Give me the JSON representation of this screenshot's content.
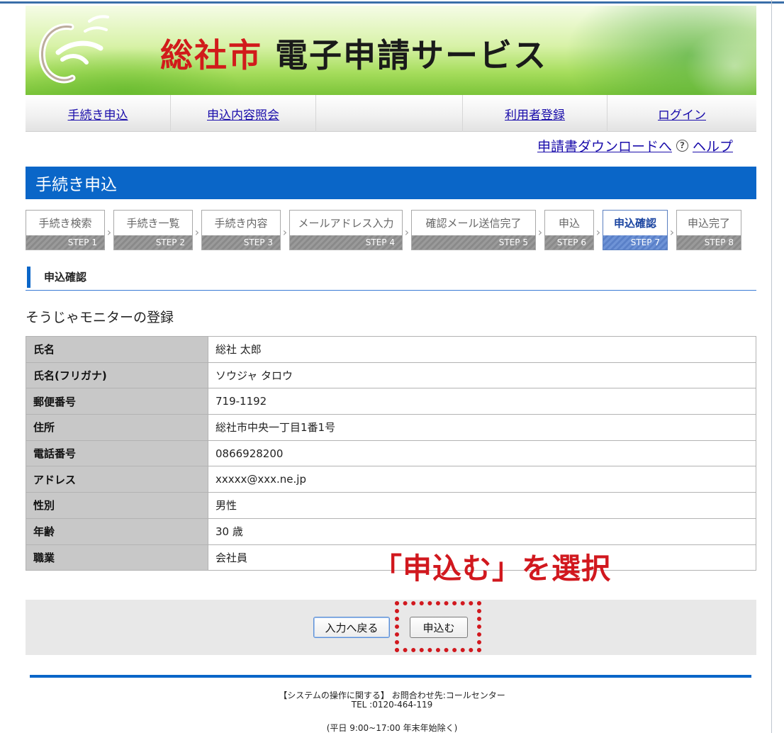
{
  "banner": {
    "city": "総社市",
    "service": "電子申請サービス"
  },
  "nav": {
    "items": [
      {
        "label": "手続き申込"
      },
      {
        "label": "申込内容照会"
      },
      {
        "label": ""
      },
      {
        "label": "利用者登録"
      },
      {
        "label": "ログイン"
      }
    ]
  },
  "sublinks": {
    "download": "申請書ダウンロードへ",
    "help_icon": "help-circle-icon",
    "help": "ヘルプ"
  },
  "page_title": "手続き申込",
  "steps": [
    {
      "label": "手続き検索",
      "num": "STEP 1",
      "active": false
    },
    {
      "label": "手続き一覧",
      "num": "STEP 2",
      "active": false
    },
    {
      "label": "手続き内容",
      "num": "STEP 3",
      "active": false
    },
    {
      "label": "メールアドレス入力",
      "num": "STEP 4",
      "active": false
    },
    {
      "label": "確認メール送信完了",
      "num": "STEP 5",
      "active": false
    },
    {
      "label": "申込",
      "num": "STEP 6",
      "active": false
    },
    {
      "label": "申込確認",
      "num": "STEP 7",
      "active": true
    },
    {
      "label": "申込完了",
      "num": "STEP 8",
      "active": false
    }
  ],
  "section_heading": "申込確認",
  "form_title": "そうじゃモニターの登録",
  "rows": [
    {
      "label": "氏名",
      "value": "総社 太郎"
    },
    {
      "label": "氏名(フリガナ)",
      "value": "ソウジャ タロウ"
    },
    {
      "label": "郵便番号",
      "value": "719-1192"
    },
    {
      "label": "住所",
      "value": "総社市中央一丁目1番1号"
    },
    {
      "label": "電話番号",
      "value": "0866928200"
    },
    {
      "label": "アドレス",
      "value": "xxxxx@xxx.ne.jp"
    },
    {
      "label": "性別",
      "value": "男性"
    },
    {
      "label": "年齢",
      "value": "30 歳"
    },
    {
      "label": "職業",
      "value": "会社員"
    }
  ],
  "annotation": "「申込む」を選択",
  "buttons": {
    "back": "入力へ戻る",
    "apply": "申込む"
  },
  "footer": {
    "line1": "【システムの操作に関する】 お問合わせ先:コールセンター",
    "line2": "TEL :0120-464-119",
    "line3": "(平日 9:00~17:00 年末年始除く)"
  },
  "colors": {
    "accent_blue": "#0a66c8",
    "annotation_red": "#d1181e",
    "city_red": "#d11b1b"
  }
}
